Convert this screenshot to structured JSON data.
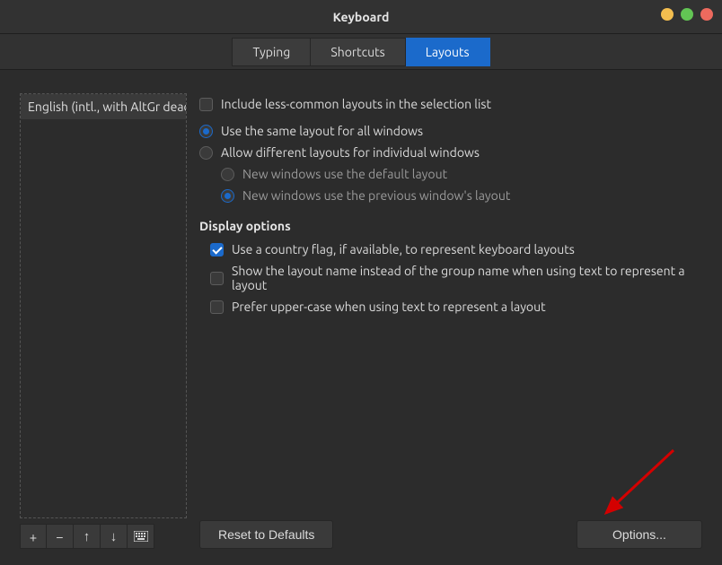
{
  "window": {
    "title": "Keyboard"
  },
  "tabs": {
    "typing": "Typing",
    "shortcuts": "Shortcuts",
    "layouts": "Layouts",
    "active": "layouts"
  },
  "sidebar": {
    "items": [
      "English (intl., with AltGr dead k"
    ]
  },
  "options": {
    "include_less_common": "Include less-common layouts in the selection list",
    "same_layout": "Use the same layout for all windows",
    "allow_different": "Allow different layouts for individual windows",
    "new_default": "New windows use the default layout",
    "new_previous": "New windows use the previous window's layout"
  },
  "display": {
    "heading": "Display options",
    "country_flag": "Use a country flag, if available,  to represent keyboard layouts",
    "layout_name": "Show the layout name instead of the group name when using text to represent a layout",
    "upper_case": "Prefer upper-case when using text to represent a layout"
  },
  "buttons": {
    "reset": "Reset to Defaults",
    "options": "Options..."
  },
  "toolbar_icons": {
    "add": "+",
    "remove": "−",
    "up": "↑",
    "down": "↓"
  }
}
